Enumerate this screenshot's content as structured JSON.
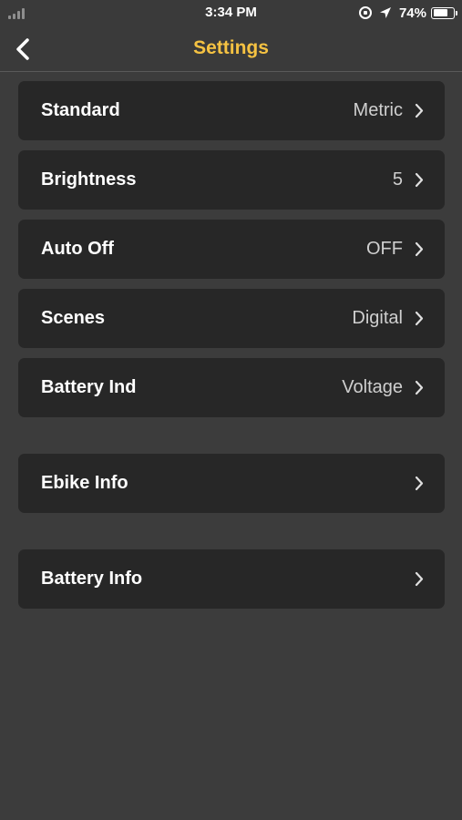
{
  "status_bar": {
    "time": "3:34 PM",
    "battery_percent": "74%",
    "battery_level": 0.74,
    "icons": [
      "signal-icon",
      "rotation-lock-icon",
      "location-arrow-icon",
      "battery-icon"
    ]
  },
  "nav": {
    "title": "Settings",
    "back_icon": "chevron-left-icon",
    "title_color": "#f5c242"
  },
  "settings": {
    "standard": {
      "label": "Standard",
      "value": "Metric"
    },
    "brightness": {
      "label": "Brightness",
      "value": "5"
    },
    "auto_off": {
      "label": "Auto Off",
      "value": "OFF"
    },
    "scenes": {
      "label": "Scenes",
      "value": "Digital"
    },
    "battery_ind": {
      "label": "Battery Ind",
      "value": "Voltage"
    },
    "ebike_info": {
      "label": "Ebike Info"
    },
    "battery_info": {
      "label": "Battery Info"
    }
  },
  "colors": {
    "background": "#3c3c3c",
    "row_background": "#272727",
    "accent": "#f5c242"
  }
}
